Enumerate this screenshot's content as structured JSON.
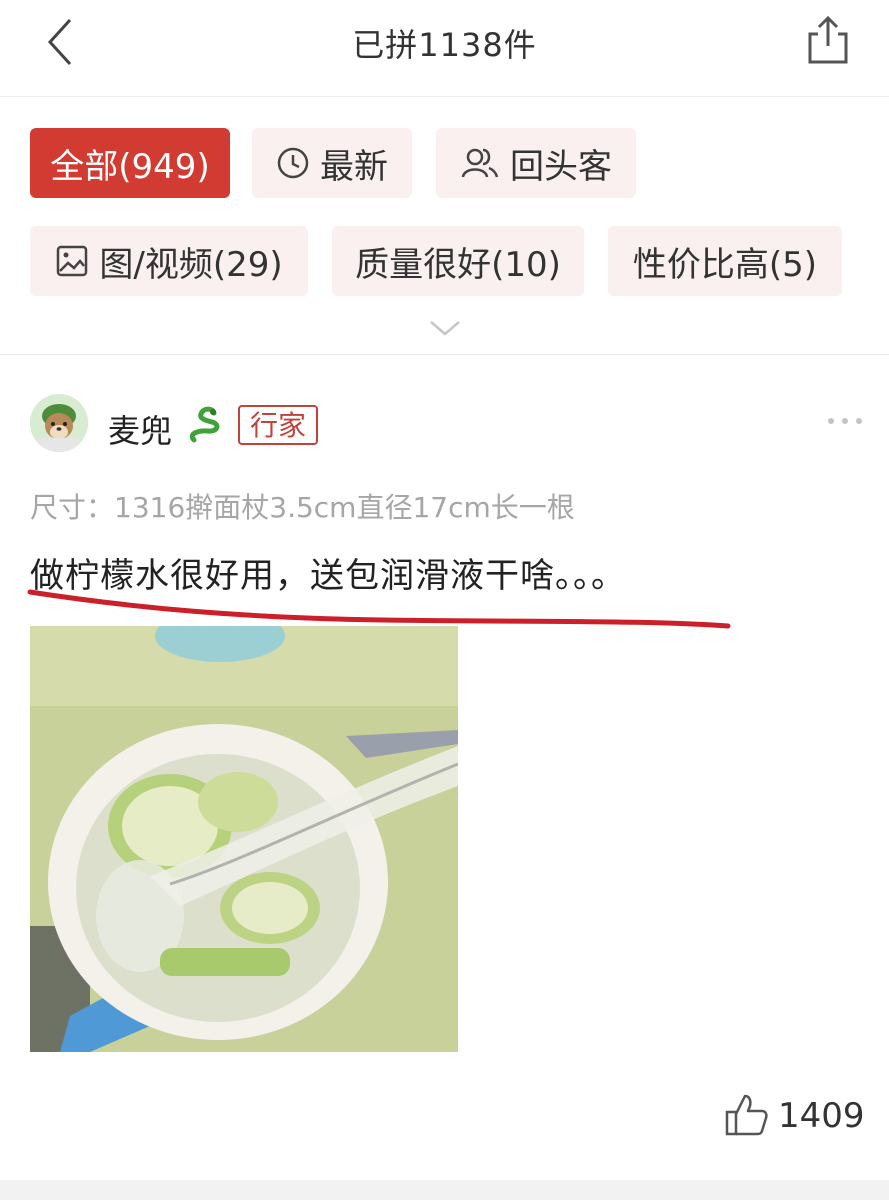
{
  "header": {
    "title": "已拼1138件",
    "back_icon": "chevron-left-icon",
    "share_icon": "share-icon"
  },
  "filters": {
    "chips": [
      {
        "label": "全部(949)",
        "icon": "",
        "active": true
      },
      {
        "label": "最新",
        "icon": "clock-icon",
        "active": false
      },
      {
        "label": "回头客",
        "icon": "users-icon",
        "active": false
      },
      {
        "label": "图/视频(29)",
        "icon": "image-icon",
        "active": false
      },
      {
        "label": "质量很好(10)",
        "icon": "",
        "active": false
      },
      {
        "label": "性价比高(5)",
        "icon": "",
        "active": false
      }
    ],
    "expand_icon": "chevron-down-icon",
    "accent_color": "#d23b32"
  },
  "review": {
    "username": "麦兜",
    "badge": "行家",
    "spec": "尺寸：1316擀面杖3.5cm直径17cm长一根",
    "content": "做柠檬水很好用，送包润滑液干啥。。。",
    "like_count": "1409",
    "underline_color": "#cc1f2a"
  }
}
